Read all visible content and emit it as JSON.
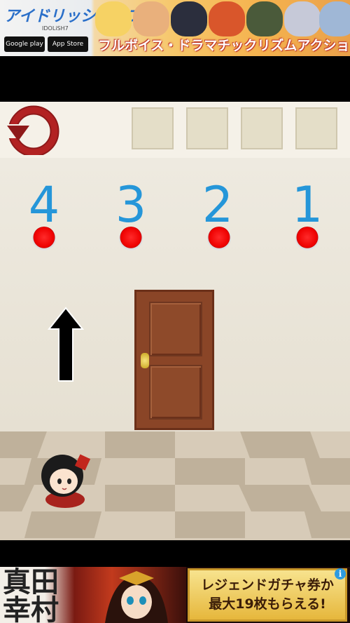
{
  "top_ad": {
    "logo": "アイドリッシュセブン",
    "logo_sub": "IDOLiSH7",
    "google_play": "Google play",
    "app_store": "App Store",
    "banner_text": "フルボイス・ドラマチックリズムアクション"
  },
  "game": {
    "inventory_slots": 4,
    "numbers": [
      "4",
      "3",
      "2",
      "1"
    ],
    "button_color": "#e00000",
    "number_color": "#2596d9",
    "arrow_direction": "up"
  },
  "bottom_ad": {
    "kanji": "真田幸村",
    "line1": "レジェンドガチャ券か",
    "line2": "最大19枚もらえる!",
    "info_icon": "i"
  }
}
